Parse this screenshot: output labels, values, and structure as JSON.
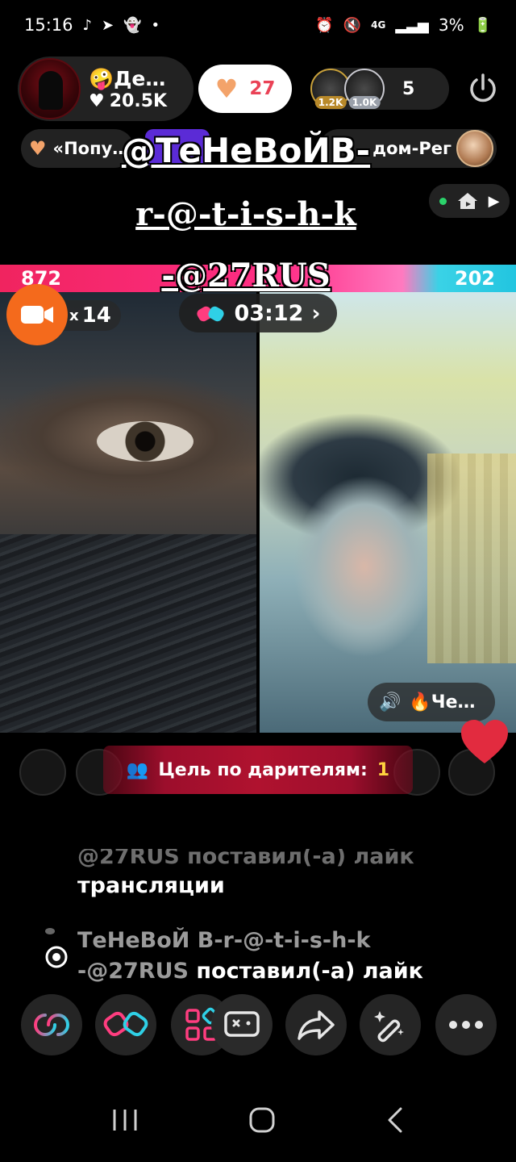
{
  "status_bar": {
    "time": "15:16",
    "network": "4G",
    "battery": "3%"
  },
  "host": {
    "name": "🤪Де…",
    "likes": "20.5K"
  },
  "likes_pill": {
    "count": "27"
  },
  "viewers": {
    "badge1": "1.2K",
    "badge2": "1.0K",
    "count": "5"
  },
  "rank_pill": {
    "label": "«Попу…"
  },
  "region_pill": {
    "label": "дом-Рег"
  },
  "overlay": {
    "line1": "@ТеНеВоЙВ-",
    "line2": "r-@-t-i-s-h-k",
    "line3": "-@27RUS"
  },
  "battle": {
    "left_score": "872",
    "right_score": "202",
    "timer": "03:12",
    "multiplier_prefix": "x",
    "multiplier_value": "14"
  },
  "guest": {
    "label": "🔥Че…"
  },
  "goal": {
    "label": "Цель по дарителям:",
    "value": "1"
  },
  "chat": {
    "line1_cut": "@27RUS поставил(-а) лайк",
    "line1_tail": "трансляции",
    "line2_name": "ТеНеВоЙ В-r-@-t-i-s-h-k",
    "line2_handle": "-@27RUS",
    "line2_action": "поставил(-а) лайк"
  },
  "colors": {
    "accent_pink": "#f0245f",
    "accent_cyan": "#22c5e0",
    "camera_orange": "#f46a1c",
    "goal_red": "#b0122f",
    "like_count": "#ea4256"
  },
  "icons": {
    "bottom_bar": [
      "multi-guest-icon",
      "battle-gloves-icon",
      "apps-grid-icon",
      "game-controller-icon",
      "share-arrow-icon",
      "magic-wand-icon",
      "more-dots-icon"
    ],
    "nav": [
      "recents-icon",
      "home-icon",
      "back-icon"
    ]
  }
}
